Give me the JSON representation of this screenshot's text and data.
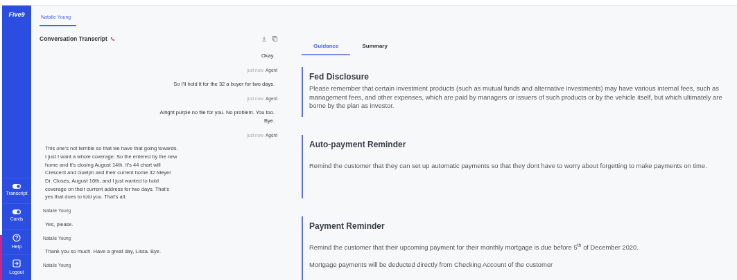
{
  "sidebar": {
    "logo": "Five9",
    "items": [
      {
        "kind": "toggle",
        "label": "Transcript",
        "on": true
      },
      {
        "kind": "toggle",
        "label": "Cards",
        "on": true
      },
      {
        "kind": "help",
        "label": "Help"
      },
      {
        "kind": "logout",
        "label": "Logout"
      }
    ]
  },
  "header_tabs": [
    {
      "label": "Natalie Young",
      "selected": true
    }
  ],
  "transcript": {
    "title": "Conversation Transcript",
    "entries": [
      {
        "kind": "agent_text",
        "text": "Okay."
      },
      {
        "kind": "agent_meta",
        "time": "just now",
        "name": "Agent"
      },
      {
        "kind": "agent_text",
        "text": "So I'll hold it for the 32 a buyer for two days."
      },
      {
        "kind": "agent_meta",
        "time": "just now",
        "name": "Agent"
      },
      {
        "kind": "agent_text",
        "text": "Alright purple no file for you. No problem. You too. Bye."
      },
      {
        "kind": "agent_meta",
        "time": "just now",
        "name": "Agent"
      },
      {
        "kind": "customer_text",
        "text": "This one's not terrible so that we have that going towards. I just I want a whole coverage. So the entered by the new home and it's closing August 14th. It's 44 chart will Crescent and Guelph and their current home 32 Meyer Dr. Closes, August 16th, and I just wanted to hold coverage on their current address for two days. That's yes that does to told you. That's all."
      },
      {
        "kind": "customer_meta",
        "name": "Natalie Young"
      },
      {
        "kind": "customer_text",
        "text": "Yes, please."
      },
      {
        "kind": "customer_meta",
        "name": "Natalie Young"
      },
      {
        "kind": "customer_text",
        "text": "Thank you so much. Have a great day, Lissa. Bye."
      },
      {
        "kind": "customer_meta",
        "name": "Natalie Young"
      }
    ]
  },
  "guidance_tabs": [
    {
      "label": "Guidance",
      "selected": true
    },
    {
      "label": "Summary",
      "selected": false
    }
  ],
  "cards": [
    {
      "title": "Fed Disclosure",
      "paragraphs": [
        "Please remember that certain investment products (such as mutual funds and alternative investments) may have various internal fees, such as management fees, and other expenses, which are paid by managers or issuers of such products or by the vehicle itself, but which ultimately are borne by the plan as investor."
      ]
    },
    {
      "title": "Auto-payment Reminder",
      "paragraphs": [
        "Remind the customer that they can set up automatic payments so that they dont have to worry about forgetting to make payments on time."
      ]
    },
    {
      "title": "Payment Reminder",
      "paragraphs": [
        "Remind the customer that their upcoming payment for their monthly mortgage is due before 5$^{th}$ of December 2020.",
        "Mortgage payments will be deducted directly from Checking Account of the customer"
      ]
    }
  ]
}
